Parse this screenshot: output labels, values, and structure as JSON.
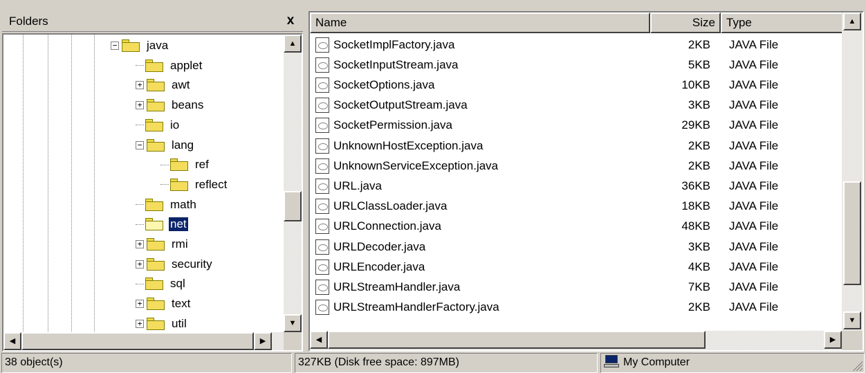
{
  "folders_pane": {
    "title": "Folders",
    "close_label": "x",
    "tree": [
      {
        "label": "java",
        "depth": 0,
        "expander": "-",
        "open": false,
        "selected": false
      },
      {
        "label": "applet",
        "depth": 1,
        "expander": "",
        "open": false,
        "selected": false
      },
      {
        "label": "awt",
        "depth": 1,
        "expander": "+",
        "open": false,
        "selected": false
      },
      {
        "label": "beans",
        "depth": 1,
        "expander": "+",
        "open": false,
        "selected": false
      },
      {
        "label": "io",
        "depth": 1,
        "expander": "",
        "open": false,
        "selected": false
      },
      {
        "label": "lang",
        "depth": 1,
        "expander": "-",
        "open": false,
        "selected": false
      },
      {
        "label": "ref",
        "depth": 2,
        "expander": "",
        "open": false,
        "selected": false
      },
      {
        "label": "reflect",
        "depth": 2,
        "expander": "",
        "open": false,
        "selected": false
      },
      {
        "label": "math",
        "depth": 1,
        "expander": "",
        "open": false,
        "selected": false
      },
      {
        "label": "net",
        "depth": 1,
        "expander": "",
        "open": true,
        "selected": true
      },
      {
        "label": "rmi",
        "depth": 1,
        "expander": "+",
        "open": false,
        "selected": false
      },
      {
        "label": "security",
        "depth": 1,
        "expander": "+",
        "open": false,
        "selected": false
      },
      {
        "label": "sql",
        "depth": 1,
        "expander": "",
        "open": false,
        "selected": false
      },
      {
        "label": "text",
        "depth": 1,
        "expander": "+",
        "open": false,
        "selected": false
      },
      {
        "label": "util",
        "depth": 1,
        "expander": "+",
        "open": false,
        "selected": false
      }
    ]
  },
  "file_list": {
    "columns": {
      "name": "Name",
      "size": "Size",
      "type": "Type"
    },
    "rows": [
      {
        "name": "SocketImplFactory.java",
        "size": "2KB",
        "type": "JAVA File"
      },
      {
        "name": "SocketInputStream.java",
        "size": "5KB",
        "type": "JAVA File"
      },
      {
        "name": "SocketOptions.java",
        "size": "10KB",
        "type": "JAVA File"
      },
      {
        "name": "SocketOutputStream.java",
        "size": "3KB",
        "type": "JAVA File"
      },
      {
        "name": "SocketPermission.java",
        "size": "29KB",
        "type": "JAVA File"
      },
      {
        "name": "UnknownHostException.java",
        "size": "2KB",
        "type": "JAVA File"
      },
      {
        "name": "UnknownServiceException.java",
        "size": "2KB",
        "type": "JAVA File"
      },
      {
        "name": "URL.java",
        "size": "36KB",
        "type": "JAVA File"
      },
      {
        "name": "URLClassLoader.java",
        "size": "18KB",
        "type": "JAVA File"
      },
      {
        "name": "URLConnection.java",
        "size": "48KB",
        "type": "JAVA File"
      },
      {
        "name": "URLDecoder.java",
        "size": "3KB",
        "type": "JAVA File"
      },
      {
        "name": "URLEncoder.java",
        "size": "4KB",
        "type": "JAVA File"
      },
      {
        "name": "URLStreamHandler.java",
        "size": "7KB",
        "type": "JAVA File"
      },
      {
        "name": "URLStreamHandlerFactory.java",
        "size": "2KB",
        "type": "JAVA File"
      }
    ]
  },
  "status_bar": {
    "objects": "38 object(s)",
    "disk": "327KB (Disk free space: 897MB)",
    "location": "My Computer"
  },
  "icons": {
    "folder": "folder-icon",
    "file": "java-file-icon",
    "computer": "my-computer-icon",
    "scroll_up": "▲",
    "scroll_down": "▼",
    "scroll_left": "◀",
    "scroll_right": "▶"
  },
  "scroll": {
    "folders_vertical_fraction": 0.6,
    "files_vertical_fraction": 0.85
  }
}
